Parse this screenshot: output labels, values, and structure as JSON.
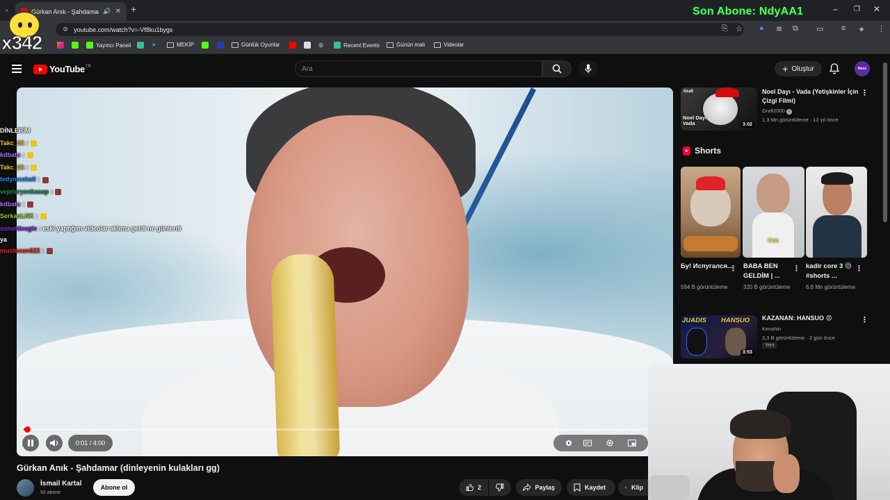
{
  "browser": {
    "tab_title": "Gürkan Anık - Şahdamar (di",
    "url": "youtube.com/watch?v=-Vf8ku1bygs",
    "bookmarks": {
      "yayinci_paneli": "Yayıncı Paneli",
      "mekip": "MEKİP",
      "gunluk_oyunlar": "Günlük Oyunlar",
      "recent_events": "Recent Events",
      "gunun_mali": "Günün malı",
      "videolar": "Videolar"
    }
  },
  "stream_overlay": {
    "last_subscriber": "Son Abone: NdyAA1",
    "logo_text": "x342"
  },
  "youtube": {
    "logo_word": "YouTube",
    "region": "TR",
    "search_placeholder": "Ara",
    "create_label": "Oluştur",
    "avatar_text": "Neox"
  },
  "player": {
    "time_current": "0:01",
    "time_separator": " / ",
    "time_total": "4:00",
    "progress": 0.004,
    "chat": [
      {
        "user": "DİNLERİM",
        "message": "",
        "color": "#ffffff",
        "emote": ""
      },
      {
        "user": "Takc_06",
        "message": ":",
        "color": "#f4c430",
        "emote": "#f0c419"
      },
      {
        "user": "kdbatu",
        "message": ":",
        "color": "#a970ff",
        "emote": "#f0c419"
      },
      {
        "user": "Takc_06",
        "message": ":",
        "color": "#f4c430",
        "emote": "#f0c419"
      },
      {
        "user": "tedymcekali",
        "message": ":",
        "color": "#1e90ff",
        "emote": "#8b3a3a"
      },
      {
        "user": "vejeteryenkasap",
        "message": ":",
        "color": "#2e8b57",
        "emote": "#8b3a3a"
      },
      {
        "user": "kdbatu",
        "message": ":",
        "color": "#a970ff",
        "emote": "#8b3a3a"
      },
      {
        "user": "SerkanLNK",
        "message": ":",
        "color": "#9acd32",
        "emote": "#f0c419"
      },
      {
        "user": "sonofdeagle",
        "message": ": eski yaptığım videolar aklıma geldi ne günlerdi ya",
        "color": "#8a2be2",
        "emote": ""
      },
      {
        "user": "mustocan622",
        "message": ":",
        "color": "#ff2020",
        "emote": "#8b3a3a"
      }
    ]
  },
  "video": {
    "title": "Gürkan Anık - Şahdamar (dinleyenin kulakları gg)",
    "channel": "İsmail Kartal",
    "subscribers": "93 abone",
    "subscribe_label": "Abone ol",
    "likes": "2",
    "share_label": "Paylaş",
    "save_label": "Kaydet",
    "clip_label": "Klip"
  },
  "sidebar": {
    "rec1": {
      "title": "Noel Dayı - Vada (Yetişkinler İçin Çizgi Filmi)",
      "channel": "Grafi2000",
      "meta": "1,3 Mn görüntüleme · 12 yıl önce",
      "duration": "3:02",
      "thumb_text": "Noel Dayı Vada",
      "thumb_brand": "Grafi"
    },
    "shorts_label": "Shorts",
    "shorts": [
      {
        "title": "Бу! Испугался...",
        "views": "594 B görüntüleme"
      },
      {
        "title": "BABA BEN GELDİM | ...",
        "views": "320 B görüntüleme",
        "overlay": "Ohh"
      },
      {
        "title": "kadir core 3 😔 #shorts ...",
        "views": "6,6 Mn görüntüleme"
      }
    ],
    "rec2": {
      "title": "KAZANAN: HANSUO 😡",
      "channel": "Kenshin",
      "meta": "3,3 B görüntüleme · 2 gün önce",
      "badge": "Yeni",
      "duration": "3:53",
      "thumb_left": "JUADIS",
      "thumb_right": "HANSUO"
    }
  },
  "colors": {
    "accent": "#ff0000",
    "overlay_green": "#4cff62",
    "background": "#0f0f0f"
  }
}
